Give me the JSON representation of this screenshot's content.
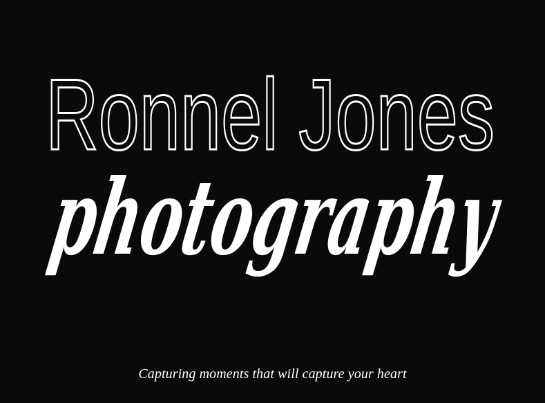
{
  "logo": {
    "name": "Ronnel Jones",
    "script": "photography"
  },
  "tagline": "Capturing moments that will capture your heart",
  "colors": {
    "background": "#0a0a0a",
    "foreground": "#ffffff"
  }
}
